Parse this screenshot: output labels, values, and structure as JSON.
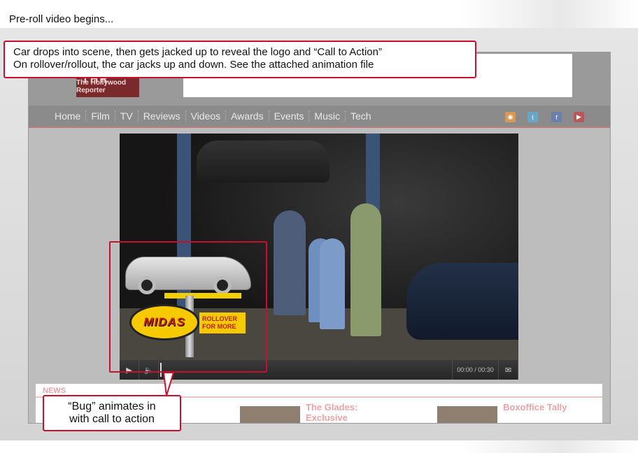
{
  "intro_text": "Pre-roll video begins...",
  "callout_top": {
    "line1": "Car drops into scene, then gets jacked up to reveal the logo and “Call to Action”",
    "line2": "On rollover/rollout, the car jacks up and down. See the attached animation file"
  },
  "callout_bug": {
    "line1": "“Bug” animates in",
    "line2": "with call to action"
  },
  "site": {
    "logo_mark": "THR",
    "logo_text": "The Hollywood Reporter",
    "nav": [
      "Home",
      "Film",
      "TV",
      "Reviews",
      "Videos",
      "Awards",
      "Events",
      "Music",
      "Tech"
    ],
    "social_icons": [
      "rss-icon",
      "twitter-icon",
      "facebook-icon",
      "youtube-icon"
    ],
    "news_label": "NEWS",
    "headlines": [
      "The Glades: Exclusive",
      "Boxoffice Tally"
    ]
  },
  "video": {
    "timecode": "00:00 / 00:30",
    "play_icon": "play-icon",
    "volume_icon": "volume-icon",
    "share_icon": "envelope-icon"
  },
  "bug": {
    "brand": "MIDAS",
    "cta_line1": "ROLLOVER",
    "cta_line2": "FOR MORE"
  },
  "colors": {
    "callout_red": "#c8102e",
    "midas_yellow": "#f6c900",
    "nav_gray": "#8b8b8b"
  }
}
